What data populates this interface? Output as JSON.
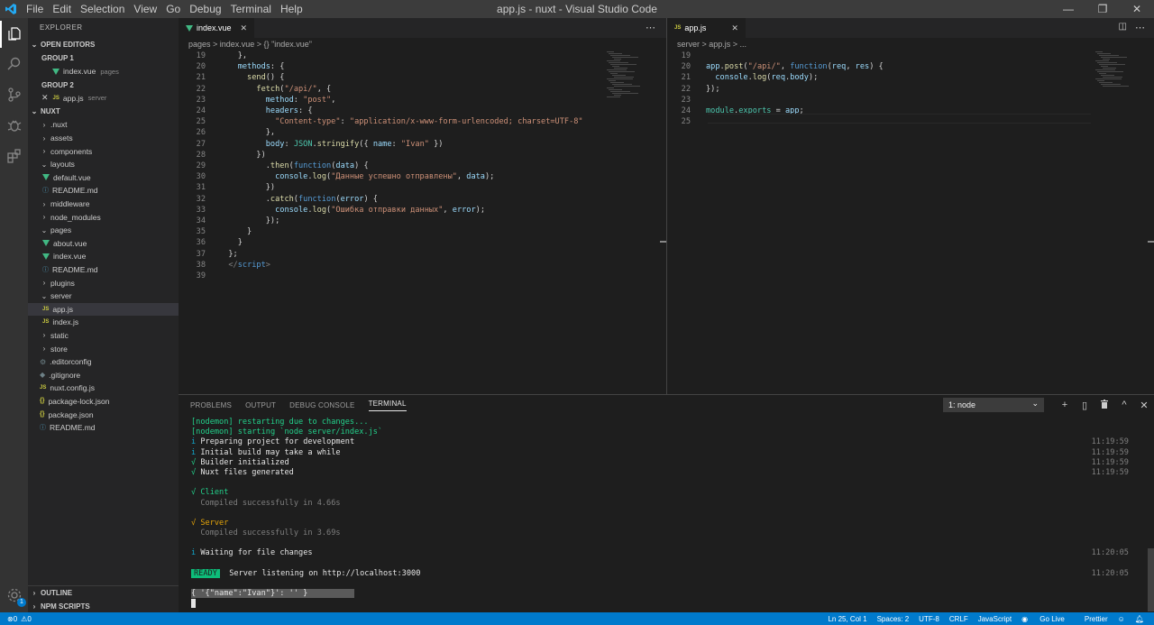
{
  "menu": [
    "File",
    "Edit",
    "Selection",
    "View",
    "Go",
    "Debug",
    "Terminal",
    "Help"
  ],
  "window_title": "app.js - nuxt - Visual Studio Code",
  "window_controls": [
    "—",
    "❐",
    "✕"
  ],
  "sidebar": {
    "title": "EXPLORER",
    "open_editors": "OPEN EDITORS",
    "group1": "GROUP 1",
    "group1_file": "index.vue",
    "group1_desc": "pages",
    "group2": "GROUP 2",
    "group2_file": "app.js",
    "group2_desc": "server",
    "project": "NUXT",
    "tree": [
      {
        "label": ".nuxt",
        "type": "folder",
        "depth": 1
      },
      {
        "label": "assets",
        "type": "folder",
        "depth": 1
      },
      {
        "label": "components",
        "type": "folder",
        "depth": 1
      },
      {
        "label": "layouts",
        "type": "folder-open",
        "depth": 1
      },
      {
        "label": "default.vue",
        "type": "vue",
        "depth": 2
      },
      {
        "label": "README.md",
        "type": "info",
        "depth": 2
      },
      {
        "label": "middleware",
        "type": "folder",
        "depth": 1
      },
      {
        "label": "node_modules",
        "type": "folder",
        "depth": 1
      },
      {
        "label": "pages",
        "type": "folder-open",
        "depth": 1
      },
      {
        "label": "about.vue",
        "type": "vue",
        "depth": 2
      },
      {
        "label": "index.vue",
        "type": "vue",
        "depth": 2
      },
      {
        "label": "README.md",
        "type": "info",
        "depth": 2
      },
      {
        "label": "plugins",
        "type": "folder",
        "depth": 1
      },
      {
        "label": "server",
        "type": "folder-open",
        "depth": 1
      },
      {
        "label": "app.js",
        "type": "js",
        "depth": 2,
        "selected": true
      },
      {
        "label": "index.js",
        "type": "js",
        "depth": 2
      },
      {
        "label": "static",
        "type": "folder",
        "depth": 1
      },
      {
        "label": "store",
        "type": "folder",
        "depth": 1
      },
      {
        "label": ".editorconfig",
        "type": "gear",
        "depth": 1
      },
      {
        "label": ".gitignore",
        "type": "dot",
        "depth": 1
      },
      {
        "label": "nuxt.config.js",
        "type": "js",
        "depth": 1
      },
      {
        "label": "package-lock.json",
        "type": "json",
        "depth": 1
      },
      {
        "label": "package.json",
        "type": "json",
        "depth": 1
      },
      {
        "label": "README.md",
        "type": "info",
        "depth": 1
      }
    ],
    "outline": "OUTLINE",
    "npm_scripts": "NPM SCRIPTS"
  },
  "left_editor": {
    "tab": "index.vue",
    "breadcrumb": "pages  >  index.vue  >  {} \"index.vue\"",
    "lines": [
      {
        "n": "19",
        "html": "    },"
      },
      {
        "n": "20",
        "html": "    <span class='t-prop'>methods</span>: {"
      },
      {
        "n": "21",
        "html": "      <span class='t-fn'>send</span>() {"
      },
      {
        "n": "22",
        "html": "        <span class='t-fn'>fetch</span>(<span class='t-str'>\"/api/\"</span>, {"
      },
      {
        "n": "23",
        "html": "          <span class='t-prop'>method</span>: <span class='t-str'>\"post\"</span>,"
      },
      {
        "n": "24",
        "html": "          <span class='t-prop'>headers</span>: {"
      },
      {
        "n": "25",
        "html": "            <span class='t-str'>\"Content-type\"</span>: <span class='t-str'>\"application/x-www-form-urlencoded; charset=UTF-8\"</span>"
      },
      {
        "n": "26",
        "html": "          },"
      },
      {
        "n": "27",
        "html": "          <span class='t-prop'>body</span>: <span class='t-cls'>JSON</span>.<span class='t-fn'>stringify</span>({ <span class='t-prop'>name</span>: <span class='t-str'>\"Ivan\"</span> })"
      },
      {
        "n": "28",
        "html": "        })"
      },
      {
        "n": "29",
        "html": "          .<span class='t-fn'>then</span>(<span class='t-kw'>function</span>(<span class='t-prop'>data</span>) {"
      },
      {
        "n": "30",
        "html": "            <span class='t-prop'>console</span>.<span class='t-fn'>log</span>(<span class='t-str'>\"Данные успешно отправлены\"</span>, <span class='t-prop'>data</span>);"
      },
      {
        "n": "31",
        "html": "          })"
      },
      {
        "n": "32",
        "html": "          .<span class='t-fn'>catch</span>(<span class='t-kw'>function</span>(<span class='t-prop'>error</span>) {"
      },
      {
        "n": "33",
        "html": "            <span class='t-prop'>console</span>.<span class='t-fn'>log</span>(<span class='t-str'>\"Ошибка отправки данных\"</span>, <span class='t-prop'>error</span>);"
      },
      {
        "n": "34",
        "html": "          });"
      },
      {
        "n": "35",
        "html": "      }"
      },
      {
        "n": "36",
        "html": "    }"
      },
      {
        "n": "37",
        "html": "  };"
      },
      {
        "n": "38",
        "html": "  <span class='t-tag'>&lt;/</span><span class='t-kw'>script</span><span class='t-tag'>&gt;</span>"
      },
      {
        "n": "39",
        "html": ""
      }
    ]
  },
  "right_editor": {
    "tab": "app.js",
    "breadcrumb": "server  >  app.js  >  ...",
    "lines": [
      {
        "n": "19",
        "html": ""
      },
      {
        "n": "20",
        "html": "<span class='t-prop'>app</span>.<span class='t-fn'>post</span>(<span class='t-str'>\"/api/\"</span>, <span class='t-kw'>function</span>(<span class='t-prop'>req</span>, <span class='t-prop'>res</span>) {"
      },
      {
        "n": "21",
        "html": "  <span class='t-prop'>console</span>.<span class='t-fn'>log</span>(<span class='t-prop'>req</span>.<span class='t-prop'>body</span>);"
      },
      {
        "n": "22",
        "html": "});"
      },
      {
        "n": "23",
        "html": ""
      },
      {
        "n": "24",
        "html": "<span class='t-cls'>module</span>.<span class='t-cls'>exports</span> = <span class='t-prop'>app</span>;"
      },
      {
        "n": "25",
        "html": ""
      }
    ]
  },
  "panel": {
    "tabs": [
      "PROBLEMS",
      "OUTPUT",
      "DEBUG CONSOLE",
      "TERMINAL"
    ],
    "active_tab": "TERMINAL",
    "terminal_select": "1: node",
    "controls": [
      "+",
      "▯",
      "🗑",
      "^",
      "✕"
    ]
  },
  "terminal": [
    {
      "text": "[nodemon] restarting due to changes...",
      "cls": "c-green",
      "time": ""
    },
    {
      "text": "[nodemon] starting `node server/index.js`",
      "cls": "c-green",
      "time": ""
    },
    {
      "text": "<span class='c-cyan'>i</span> <span class='c-white'>Preparing project for development</span>",
      "cls": "",
      "time": "11:19:59"
    },
    {
      "text": "<span class='c-cyan'>i</span> <span class='c-white'>Initial build may take a while</span>",
      "cls": "",
      "time": "11:19:59"
    },
    {
      "text": "<span class='c-green'>√</span> <span class='c-white'>Builder initialized</span>",
      "cls": "",
      "time": "11:19:59"
    },
    {
      "text": "<span class='c-green'>√</span> <span class='c-white'>Nuxt files generated</span>",
      "cls": "",
      "time": "11:19:59"
    },
    {
      "text": "",
      "cls": "",
      "time": ""
    },
    {
      "text": "<span class='c-green'>√ Client</span>",
      "cls": "",
      "time": ""
    },
    {
      "text": "  <span class='c-gray'>Compiled successfully in 4.66s</span>",
      "cls": "",
      "time": ""
    },
    {
      "text": "",
      "cls": "",
      "time": ""
    },
    {
      "text": "<span class='c-orange'>√ Server</span>",
      "cls": "",
      "time": ""
    },
    {
      "text": "  <span class='c-gray'>Compiled successfully in 3.69s</span>",
      "cls": "",
      "time": ""
    },
    {
      "text": "",
      "cls": "",
      "time": ""
    },
    {
      "text": "<span class='c-cyan'>i</span> <span class='c-white'>Waiting for file changes</span>",
      "cls": "",
      "time": "11:20:05"
    },
    {
      "text": "",
      "cls": "",
      "time": ""
    },
    {
      "text": "<span class='ready'>READY</span>  <span class='c-white'>Server listening on http://localhost:3000</span>",
      "cls": "",
      "time": "11:20:05"
    },
    {
      "text": "",
      "cls": "",
      "time": ""
    },
    {
      "text": "<span style='background:#5a5a5a;color:#e5e5e5'>{ '{\"name\":\"Ivan\"}': '' }          </span>",
      "cls": "",
      "time": ""
    },
    {
      "text": "<span style='background:#e5e5e5'> </span>",
      "cls": "",
      "time": ""
    }
  ],
  "status": {
    "errors": "0",
    "warnings": "0",
    "position": "Ln 25, Col 1",
    "spaces": "Spaces: 2",
    "encoding": "UTF-8",
    "eol": "CRLF",
    "language": "JavaScript",
    "golive": "Go Live",
    "prettier": "Prettier"
  },
  "colors": {
    "accent": "#007acc",
    "vue": "#41b883",
    "js": "#cbcb41"
  }
}
